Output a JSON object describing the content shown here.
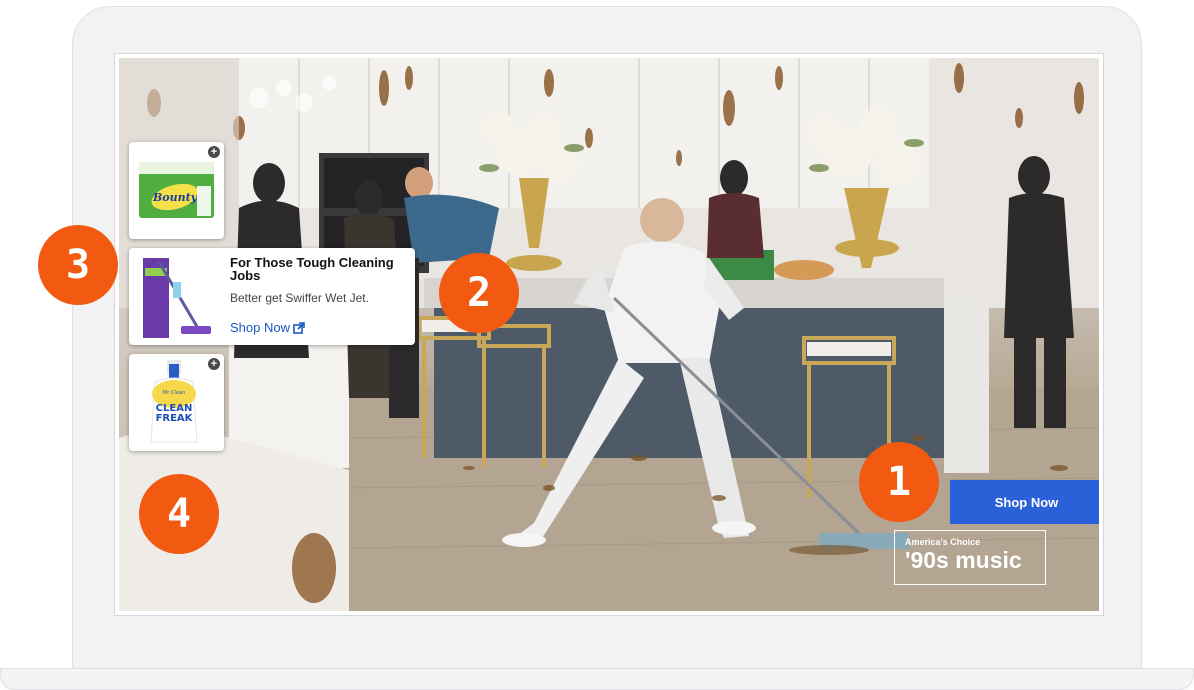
{
  "expanded_card": {
    "title": "For Those Tough Cleaning Jobs",
    "subtitle": "Better get Swiffer Wet Jet.",
    "link_label": "Shop Now",
    "link_icon": "external-link-icon"
  },
  "products": {
    "top": {
      "brand": "Bounty"
    },
    "bottom": {
      "brand": "Mr Clean",
      "line1": "CLEAN",
      "line2": "FREAK"
    }
  },
  "cta": {
    "label": "Shop Now"
  },
  "music_badge": {
    "top": "America's Choice",
    "main": "'90s music"
  },
  "markers": [
    "1",
    "2",
    "3",
    "4"
  ],
  "colors": {
    "marker": "#f25a12",
    "cta": "#2a60d8",
    "link": "#1a56c4"
  }
}
